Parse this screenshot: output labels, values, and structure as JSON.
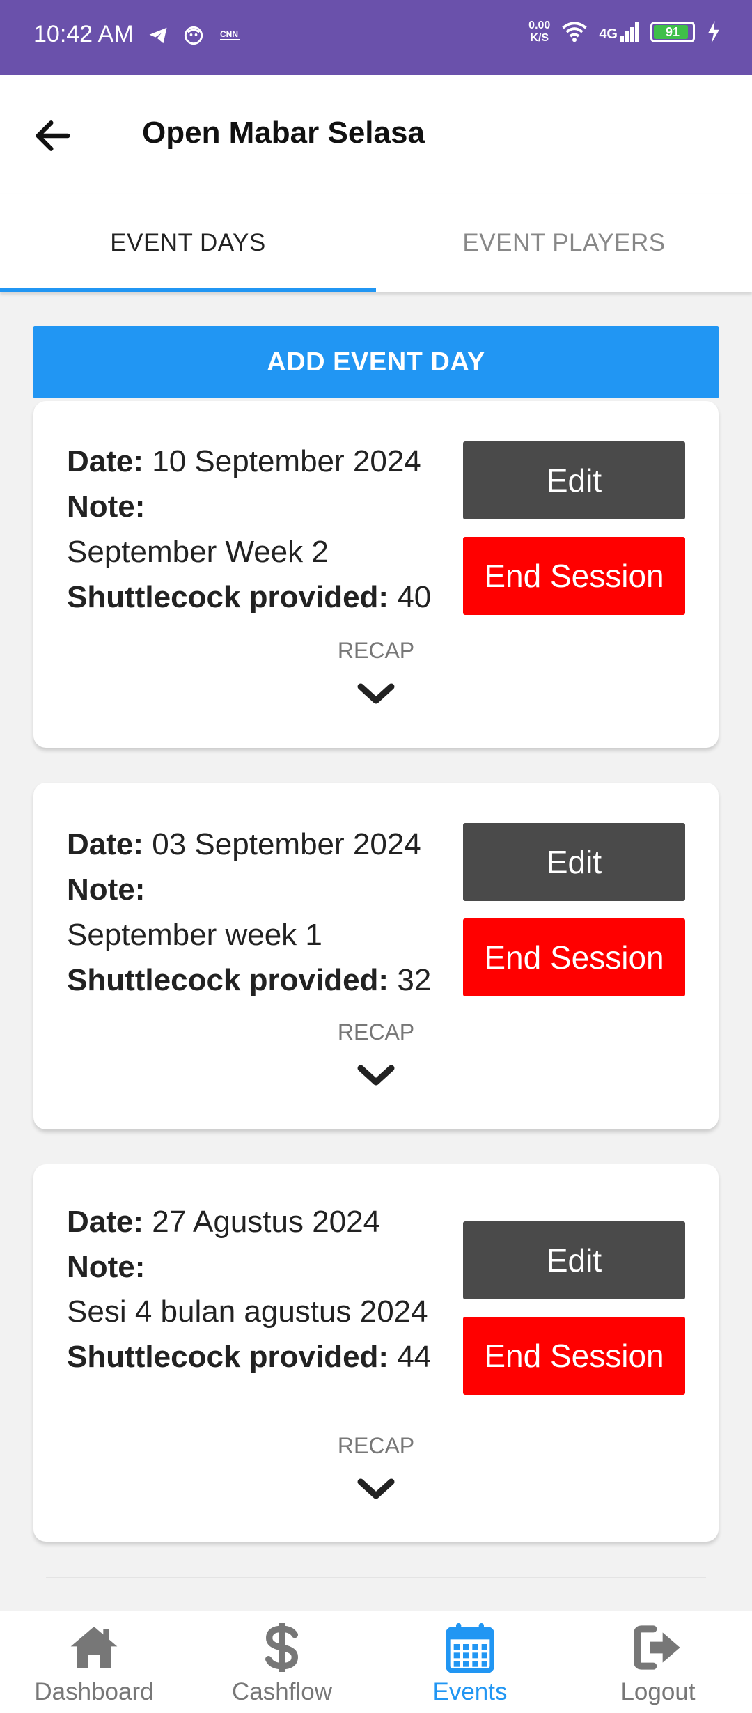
{
  "status_bar": {
    "time": "10:42 AM",
    "net_speed_value": "0.00",
    "net_speed_unit": "K/S",
    "network": "4G",
    "battery": "91",
    "battery_level": 0.91,
    "icons": [
      "telegram-icon",
      "face-icon",
      "cnn-icon",
      "wifi-icon",
      "signal-icon",
      "battery-icon",
      "charging-icon"
    ]
  },
  "app_bar": {
    "title": "Open Mabar Selasa",
    "back_icon": "arrow-left-icon"
  },
  "tabs": [
    {
      "label": "EVENT DAYS",
      "active": true
    },
    {
      "label": "EVENT PLAYERS",
      "active": false
    }
  ],
  "add_button": "ADD EVENT DAY",
  "labels": {
    "date": "Date:",
    "note": "Note:",
    "shuttlecock": "Shuttlecock provided:",
    "edit": "Edit",
    "end_session": "End Session",
    "recap": "RECAP"
  },
  "event_days": [
    {
      "date": "10 September 2024",
      "note": "September Week 2",
      "shuttlecock": "40"
    },
    {
      "date": "03 September 2024",
      "note": "September week 1",
      "shuttlecock": "32"
    },
    {
      "date": "27 Agustus 2024",
      "note": "Sesi 4 bulan agustus 2024",
      "shuttlecock": "44"
    }
  ],
  "bottom_nav": [
    {
      "label": "Dashboard",
      "icon": "home-icon",
      "active": false
    },
    {
      "label": "Cashflow",
      "icon": "dollar-icon",
      "active": false
    },
    {
      "label": "Events",
      "icon": "calendar-icon",
      "active": true
    },
    {
      "label": "Logout",
      "icon": "logout-icon",
      "active": false
    }
  ],
  "colors": {
    "status_bar": "#6a51ab",
    "accent": "#2196f3",
    "edit_button": "#4a4a4a",
    "end_button": "#ff0000"
  }
}
